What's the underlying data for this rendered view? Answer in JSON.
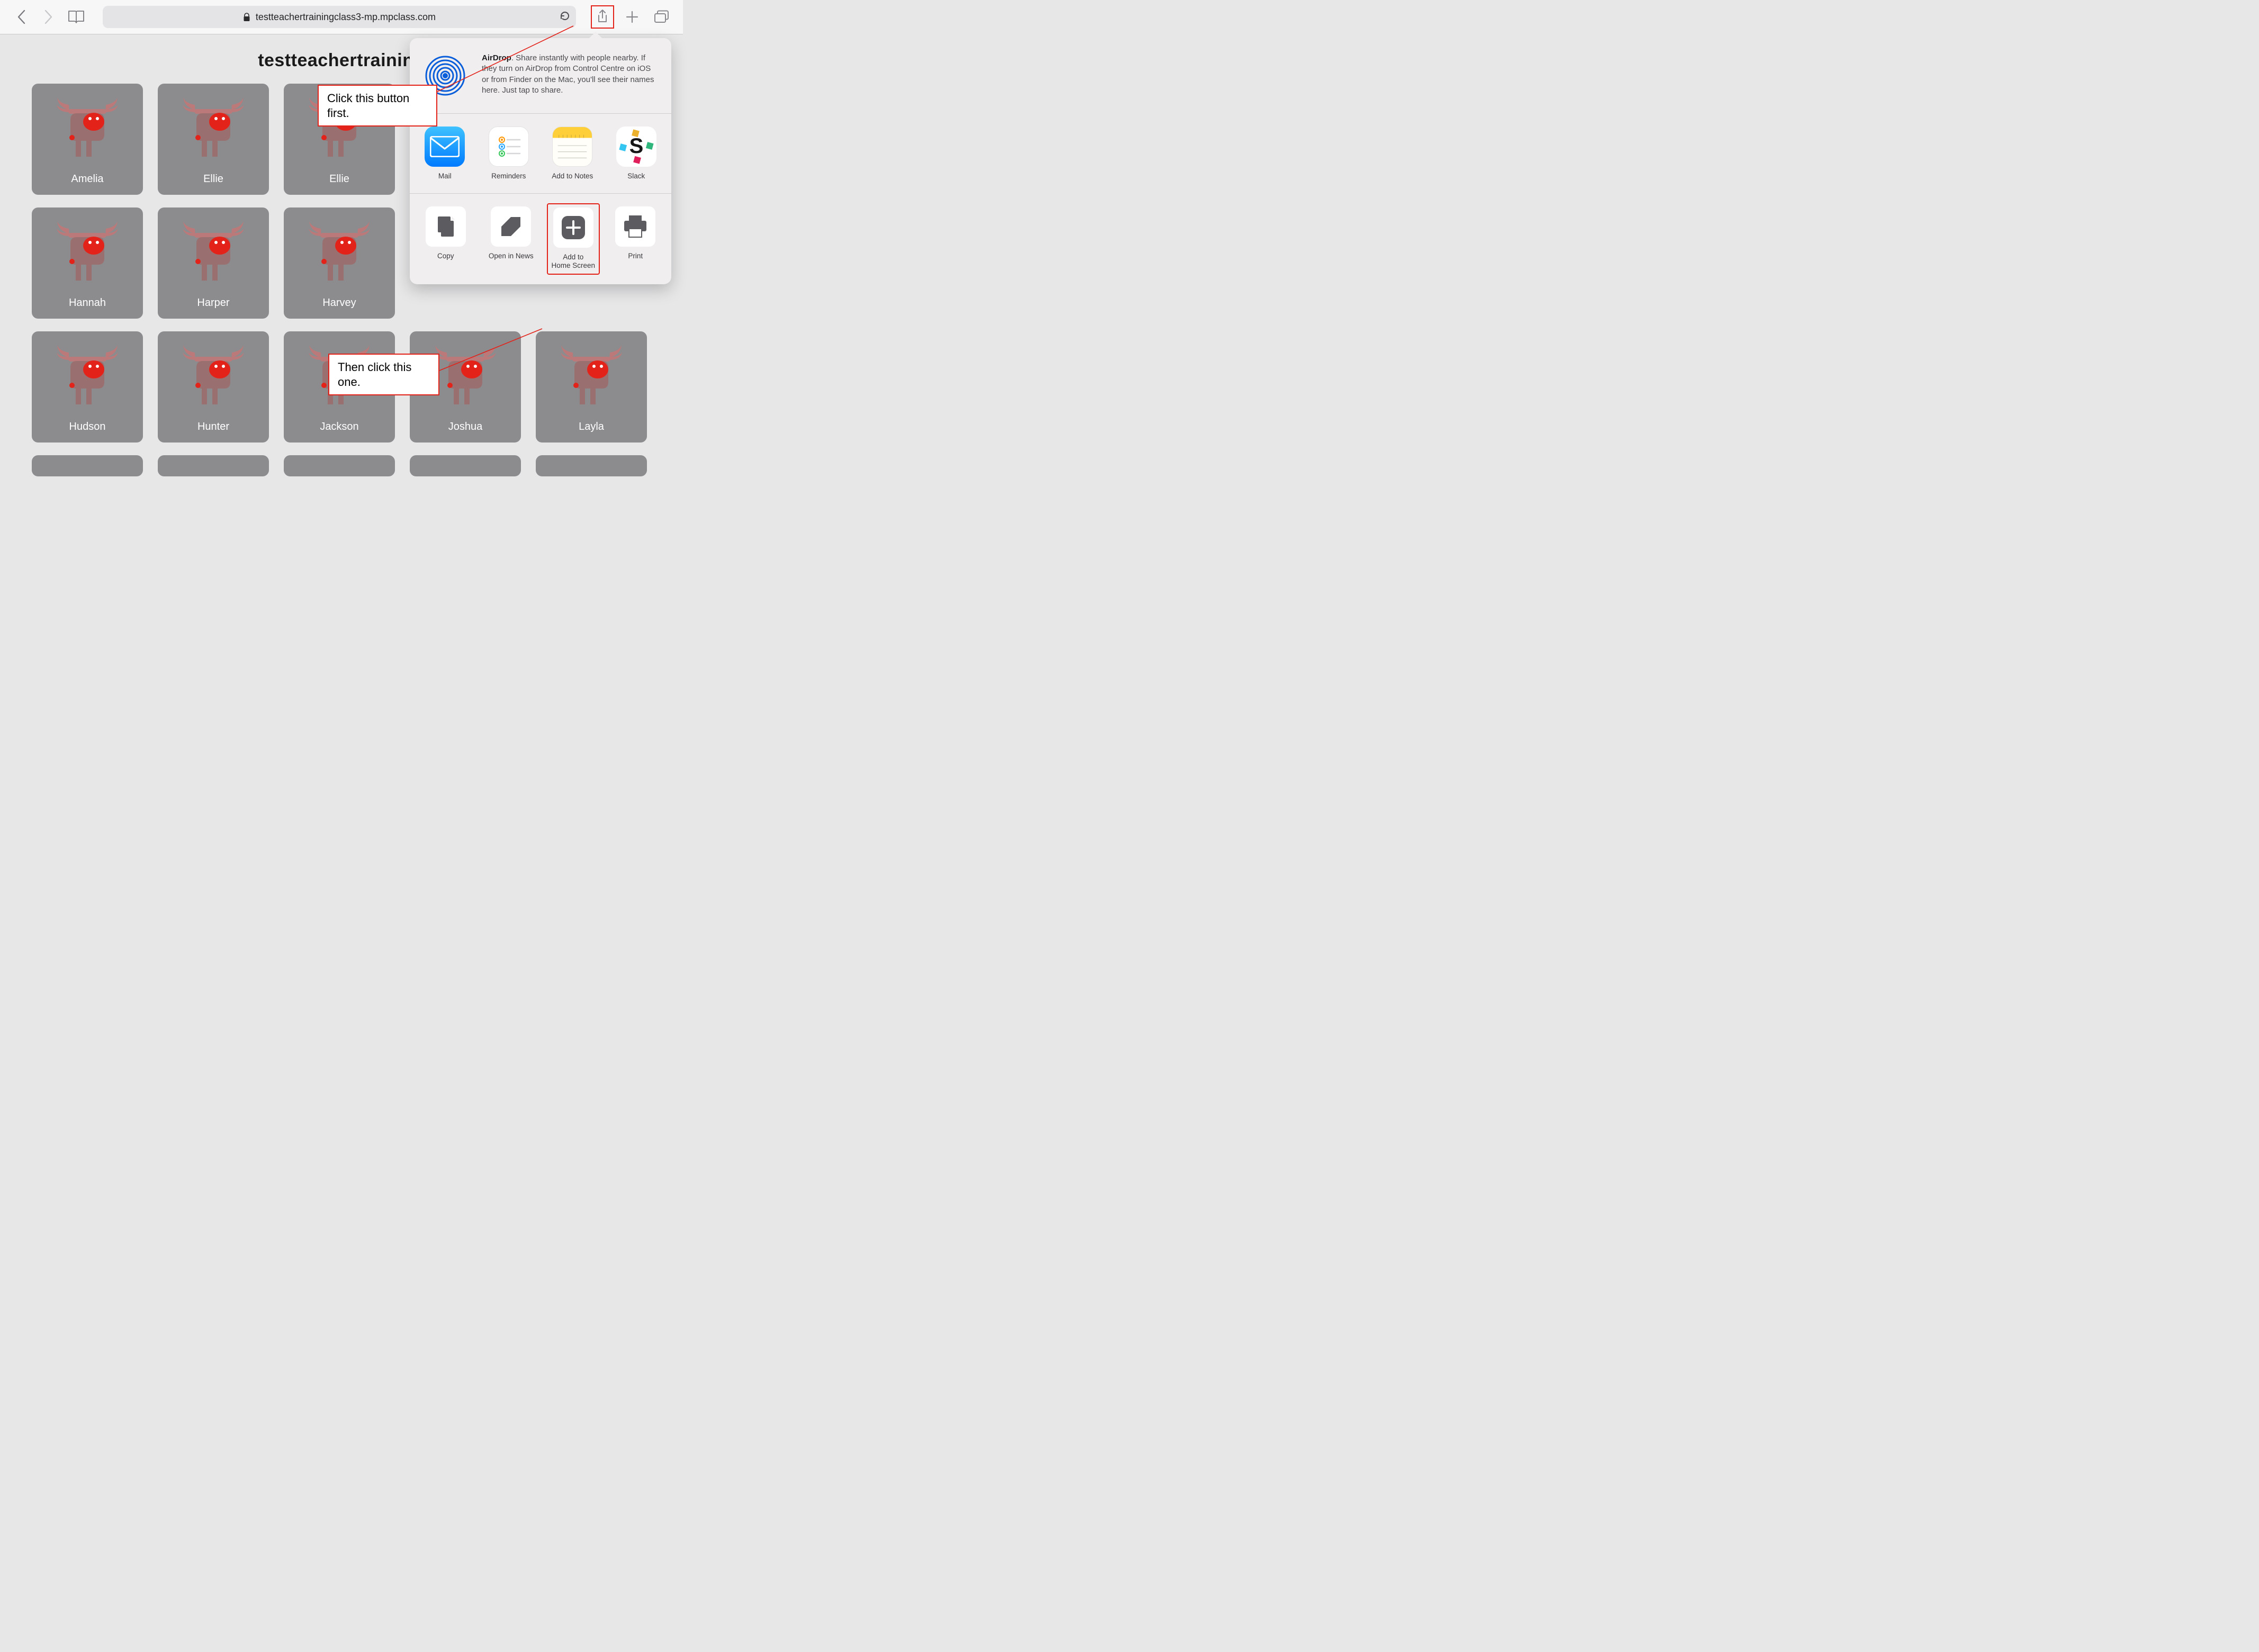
{
  "toolbar": {
    "url": "testteachertrainingclass3-mp.mpclass.com",
    "icons": {
      "back": "back-icon",
      "forward": "forward-icon",
      "bookmarks": "bookmarks-icon",
      "lock": "lock-icon",
      "reload": "reload-icon",
      "share": "share-icon",
      "newtab": "newtab-icon",
      "tabs": "tabs-icon"
    }
  },
  "page": {
    "title_visible": "testteachertraining"
  },
  "students": [
    {
      "name": "Amelia"
    },
    {
      "name": "Ellie"
    },
    {
      "name": "Ellie"
    },
    {
      "name": "Hannah"
    },
    {
      "name": "Harper"
    },
    {
      "name": "Harvey"
    },
    {
      "name": "Hudson"
    },
    {
      "name": "Hunter"
    },
    {
      "name": "Jackson"
    },
    {
      "name": "Joshua"
    },
    {
      "name": "Layla"
    }
  ],
  "share_sheet": {
    "airdrop": {
      "bold": "AirDrop",
      "text": ". Share instantly with people nearby. If they turn on AirDrop from Control Centre on iOS or from Finder on the Mac, you'll see their names here. Just tap to share."
    },
    "apps": [
      {
        "label": "Mail",
        "id": "mail"
      },
      {
        "label": "Reminders",
        "id": "reminders"
      },
      {
        "label": "Add to Notes",
        "id": "notes"
      },
      {
        "label": "Slack",
        "id": "slack"
      }
    ],
    "actions": [
      {
        "label": "Copy",
        "id": "copy"
      },
      {
        "label": "Open in News",
        "id": "news"
      },
      {
        "label": "Add to\nHome Screen",
        "id": "homescreen"
      },
      {
        "label": "Print",
        "id": "print"
      }
    ]
  },
  "annotations": {
    "callout1": "Click this button first.",
    "callout2": "Then click this one."
  }
}
